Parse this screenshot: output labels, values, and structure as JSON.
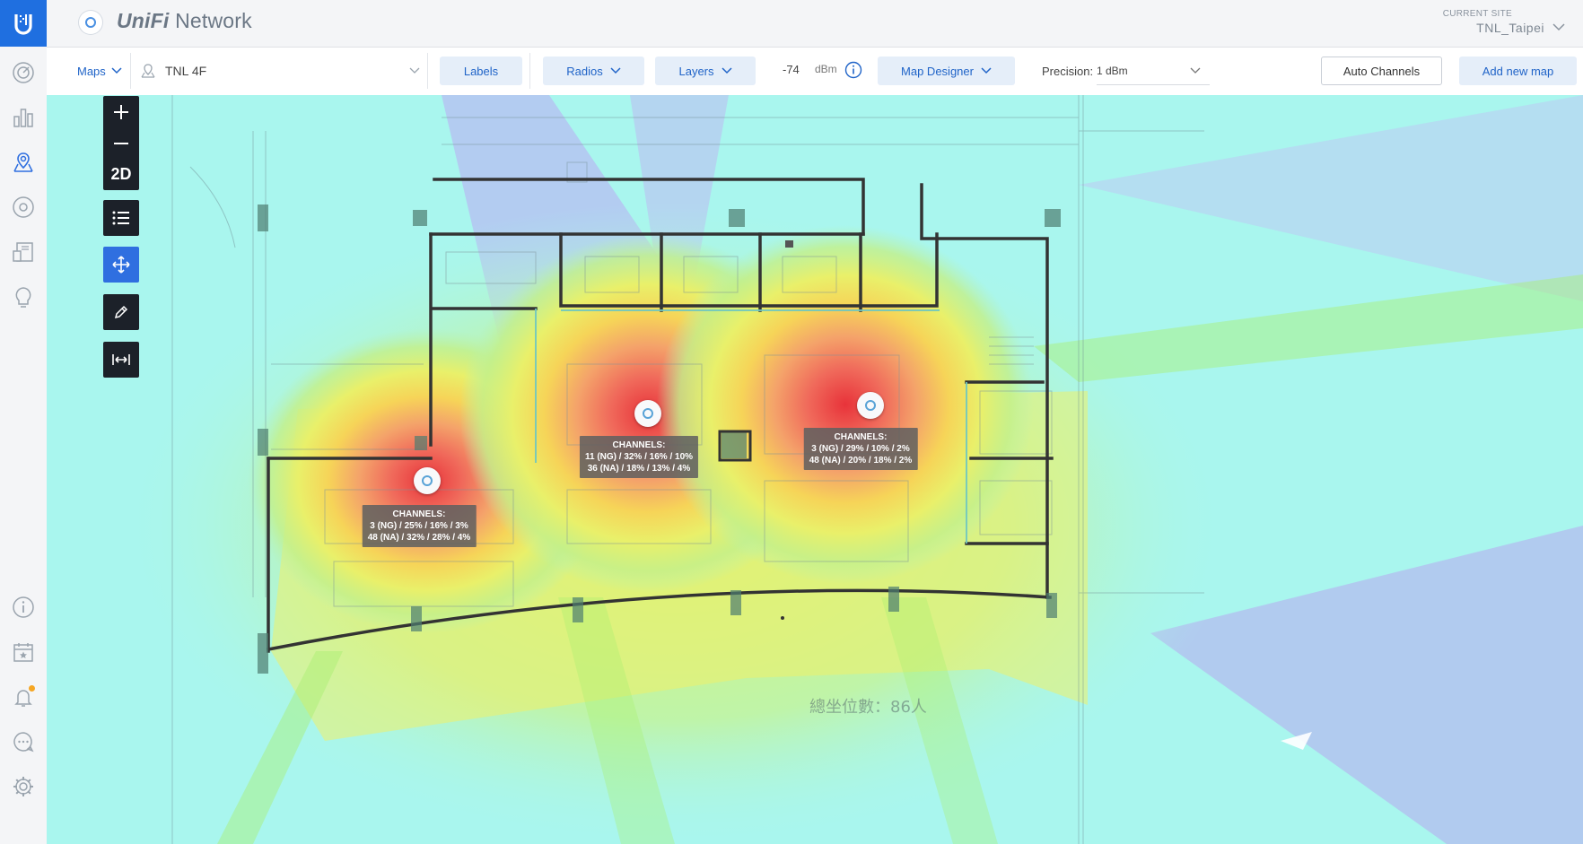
{
  "app": {
    "logo_icon": "ubiquiti-u-logo",
    "brand_prefix": "UniFi",
    "brand_suffix": " Network"
  },
  "site": {
    "caption": "CURRENT SITE",
    "name": "TNL_Taipei"
  },
  "sidebar": {
    "items": [
      {
        "name": "dashboard-icon"
      },
      {
        "name": "statistics-icon"
      },
      {
        "name": "map-icon",
        "active": true
      },
      {
        "name": "devices-icon"
      },
      {
        "name": "clients-icon"
      },
      {
        "name": "insights-icon"
      },
      {
        "name": "info-icon"
      },
      {
        "name": "events-icon"
      },
      {
        "name": "alerts-icon",
        "badge": true
      },
      {
        "name": "chat-icon"
      },
      {
        "name": "settings-icon"
      }
    ]
  },
  "toolbar": {
    "maps_label": "Maps",
    "map_name": "TNL 4F",
    "labels_label": "Labels",
    "radios_label": "Radios",
    "layers_label": "Layers",
    "signal_value": "-74",
    "signal_unit": "dBm",
    "map_designer_label": "Map Designer",
    "precision_label": "Precision:",
    "precision_value": "1 dBm",
    "auto_channels_label": "Auto Channels",
    "add_map_label": "Add new map"
  },
  "map_controls": {
    "view_mode": "2D",
    "zoom_in": "zoom-in-icon",
    "zoom_out": "zoom-out-icon",
    "list": "list-icon",
    "move": "move-icon",
    "draw": "pencil-icon",
    "measure": "measure-icon"
  },
  "floorplan_text": {
    "seat_total": "總坐位數：86人"
  },
  "access_points": [
    {
      "id": "ap-1",
      "channels_title": "CHANNELS:",
      "line_ng": "3 (NG) / 25% / 16% / 3%",
      "line_na": "48 (NA) / 32% / 28% / 4%"
    },
    {
      "id": "ap-2",
      "channels_title": "CHANNELS:",
      "line_ng": "11 (NG) / 32% / 16% / 10%",
      "line_na": "36 (NA) / 18% / 13% / 4%"
    },
    {
      "id": "ap-3",
      "channels_title": "CHANNELS:",
      "line_ng": "3 (NG) / 29% / 10% / 2%",
      "line_na": "48 (NA) / 20% / 18% / 2%"
    }
  ],
  "colors": {
    "brand_blue": "#1f6fe0",
    "pill_bg": "#e5eef9",
    "pill_text": "#2064c8",
    "heat_strong": "#e8333a",
    "heat_mid": "#f6c83a",
    "heat_weak": "#a9f6ee",
    "alert_badge": "#f5a623"
  }
}
